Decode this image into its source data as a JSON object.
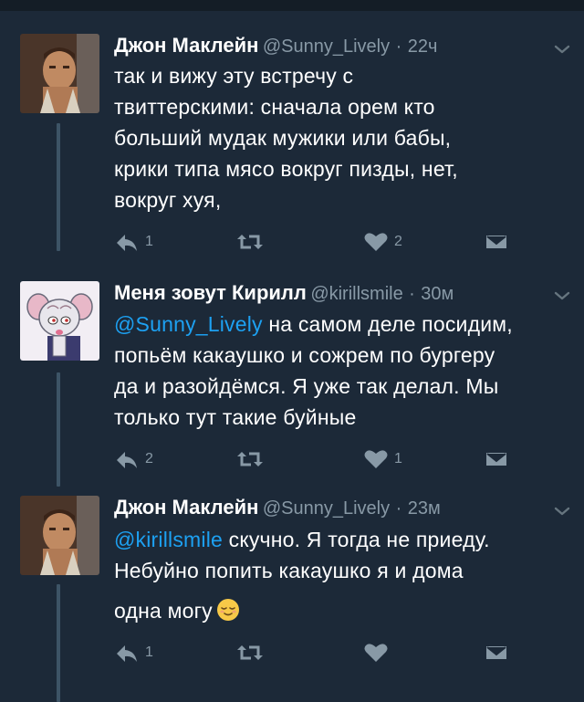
{
  "tweets": [
    {
      "name": "Джон Маклейн",
      "handle": "@Sunny_Lively",
      "separator": "·",
      "time": "22ч",
      "mention": "",
      "text_lines": [
        "так и вижу эту встречу с",
        "твиттерскими: сначала орем кто",
        "больший мудак мужики или бабы,",
        "крики типа мясо вокруг пизды, нет,",
        "вокруг хуя,"
      ],
      "reply_count": "1",
      "retweet_count": "",
      "like_count": "2",
      "avatar_icon": "john-mclane-avatar"
    },
    {
      "name": "Меня зовут Кирилл",
      "handle": "@kirillsmile",
      "separator": "·",
      "time": "30м",
      "mention": "@Sunny_Lively",
      "first_line_rest": " на самом деле посидим,",
      "text_lines": [
        "попьём какаушко и сожрем по бургеру",
        "да и разойдёмся. Я уже так делал. Мы",
        "только тут такие буйные"
      ],
      "reply_count": "2",
      "retweet_count": "",
      "like_count": "1",
      "avatar_icon": "brain-mouse-avatar"
    },
    {
      "name": "Джон Маклейн",
      "handle": "@Sunny_Lively",
      "separator": "·",
      "time": "23м",
      "mention": "@kirillsmile",
      "first_line_rest": " скучно. Я тогда не приеду.",
      "text_lines": [
        "Небуйно попить какаушко я и дома",
        "одна могу"
      ],
      "reply_count": "1",
      "retweet_count": "",
      "like_count": "",
      "avatar_icon": "john-mclane-avatar",
      "emoji_icon": "relieved-face-emoji"
    }
  ],
  "icons": {
    "reply": "reply-icon",
    "retweet": "retweet-icon",
    "like": "heart-icon",
    "dm": "direct-message-icon",
    "menu": "chevron-down-icon"
  },
  "colors": {
    "background": "#1c2938",
    "text": "#ffffff",
    "secondary": "#8899a6",
    "link": "#1da1f2",
    "thread_line": "#3d5466"
  }
}
